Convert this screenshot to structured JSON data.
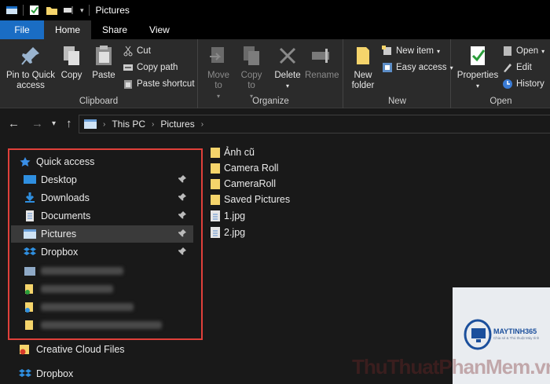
{
  "window": {
    "title": "Pictures"
  },
  "tabs": [
    "File",
    "Home",
    "Share",
    "View"
  ],
  "ribbon": {
    "clipboard": {
      "label": "Clipboard",
      "pin_quick_access": "Pin to Quick access",
      "copy": "Copy",
      "paste": "Paste",
      "cut": "Cut",
      "copy_path": "Copy path",
      "paste_shortcut": "Paste shortcut"
    },
    "organize": {
      "label": "Organize",
      "move_to": "Move to",
      "copy_to": "Copy to",
      "delete": "Delete",
      "rename": "Rename"
    },
    "new": {
      "label": "New",
      "new_folder": "New folder",
      "new_item": "New item",
      "easy_access": "Easy access"
    },
    "open": {
      "label": "Open",
      "properties": "Properties",
      "open": "Open",
      "edit": "Edit",
      "history": "History"
    }
  },
  "address": {
    "crumbs": [
      "This PC",
      "Pictures"
    ]
  },
  "nav": {
    "quick_access": "Quick access",
    "items": [
      {
        "label": "Desktop",
        "pinned": true
      },
      {
        "label": "Downloads",
        "pinned": true
      },
      {
        "label": "Documents",
        "pinned": true
      },
      {
        "label": "Pictures",
        "pinned": true,
        "selected": true
      },
      {
        "label": "Dropbox",
        "pinned": true
      }
    ],
    "creative_cloud": "Creative Cloud Files",
    "dropbox_root": "Dropbox"
  },
  "files": [
    "Ảnh cũ",
    "Camera Roll",
    "CameraRoll",
    "Saved Pictures",
    "1.jpg",
    "2.jpg"
  ],
  "watermark": {
    "brand": "MAYTINH365",
    "tagline": "Chia sẻ & Thủ thuật Máy tính",
    "site": "ThuThuatPhanMem.vn"
  },
  "colors": {
    "accent": "#1a6dc4",
    "highlight": "#e0403a",
    "folder": "#f5d46b"
  }
}
